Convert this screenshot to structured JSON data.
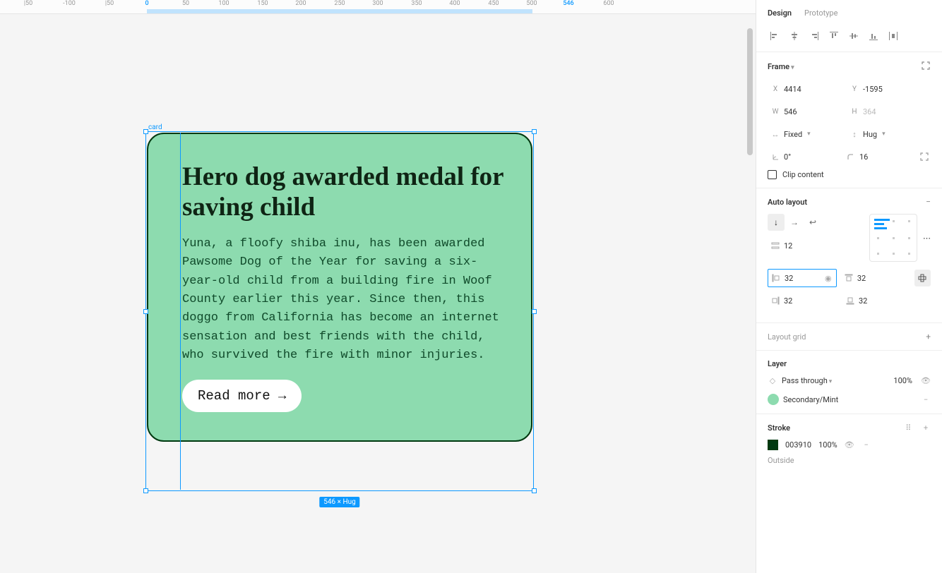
{
  "ruler": {
    "ticks": [
      {
        "label": "|50",
        "px": 40,
        "cls": ""
      },
      {
        "label": "-100",
        "px": 98,
        "cls": ""
      },
      {
        "label": "|50",
        "px": 155,
        "cls": ""
      },
      {
        "label": "0",
        "px": 208,
        "cls": "origin"
      },
      {
        "label": "50",
        "px": 263,
        "cls": ""
      },
      {
        "label": "100",
        "px": 317,
        "cls": ""
      },
      {
        "label": "150",
        "px": 372,
        "cls": ""
      },
      {
        "label": "200",
        "px": 426,
        "cls": ""
      },
      {
        "label": "250",
        "px": 481,
        "cls": ""
      },
      {
        "label": "300",
        "px": 535,
        "cls": ""
      },
      {
        "label": "350",
        "px": 590,
        "cls": ""
      },
      {
        "label": "400",
        "px": 644,
        "cls": ""
      },
      {
        "label": "450",
        "px": 699,
        "cls": ""
      },
      {
        "label": "500",
        "px": 753,
        "cls": ""
      },
      {
        "label": "546",
        "px": 805,
        "cls": "sel"
      },
      {
        "label": "600",
        "px": 862,
        "cls": ""
      }
    ]
  },
  "canvas": {
    "frame_label": "card",
    "card": {
      "title": "Hero dog awarded medal for saving child",
      "body": "Yuna, a floofy shiba inu, has been awarded Pawsome Dog of the Year for saving a six-year-old child from a building fire in Woof County earlier this year. Since then, this doggo from California has become an internet sensation and best friends with the child, who survived the fire with minor injuries.",
      "cta": "Read more →"
    },
    "dims_badge": "546 × Hug"
  },
  "panel": {
    "tabs": {
      "design": "Design",
      "prototype": "Prototype"
    },
    "frame": {
      "title": "Frame",
      "x": "4414",
      "y": "-1595",
      "w": "546",
      "h": "364",
      "w_mode": "Fixed",
      "h_mode": "Hug",
      "rotation": "0°",
      "radius": "16",
      "clip": "Clip content"
    },
    "autolayout": {
      "title": "Auto layout",
      "gap": "12",
      "pad_left": "32",
      "pad_top": "32",
      "pad_right": "32",
      "pad_bottom": "32"
    },
    "layoutgrid": {
      "title": "Layout grid"
    },
    "layer": {
      "title": "Layer",
      "blend": "Pass through",
      "opacity": "100%",
      "fill_name": "Secondary/Mint",
      "fill_hex": "#8ddbaf"
    },
    "stroke": {
      "title": "Stroke",
      "hex": "003910",
      "opacity": "100%",
      "position": "Outside"
    }
  }
}
